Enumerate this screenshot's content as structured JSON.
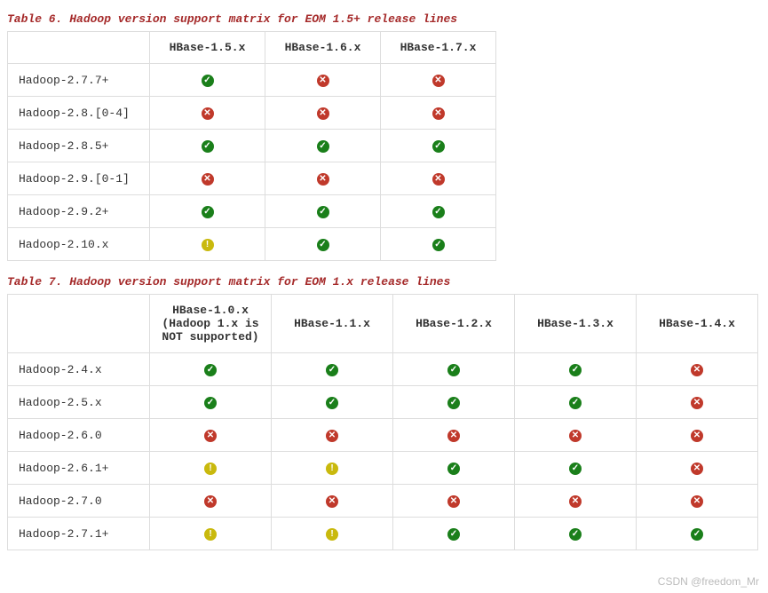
{
  "watermark": "CSDN @freedom_Mr",
  "icons": {
    "ok": "✓",
    "no": "✕",
    "wr": "!"
  },
  "table6": {
    "caption": "Table 6. Hadoop version support matrix for EOM 1.5+ release lines",
    "headers": [
      "HBase-1.5.x",
      "HBase-1.6.x",
      "HBase-1.7.x"
    ],
    "rows": [
      {
        "label": "Hadoop-2.7.7+",
        "cells": [
          "ok",
          "no",
          "no"
        ]
      },
      {
        "label": "Hadoop-2.8.[0-4]",
        "cells": [
          "no",
          "no",
          "no"
        ]
      },
      {
        "label": "Hadoop-2.8.5+",
        "cells": [
          "ok",
          "ok",
          "ok"
        ]
      },
      {
        "label": "Hadoop-2.9.[0-1]",
        "cells": [
          "no",
          "no",
          "no"
        ]
      },
      {
        "label": "Hadoop-2.9.2+",
        "cells": [
          "ok",
          "ok",
          "ok"
        ]
      },
      {
        "label": "Hadoop-2.10.x",
        "cells": [
          "wr",
          "ok",
          "ok"
        ]
      }
    ]
  },
  "table7": {
    "caption": "Table 7. Hadoop version support matrix for EOM 1.x release lines",
    "headers": [
      "HBase-1.0.x (Hadoop 1.x is NOT supported)",
      "HBase-1.1.x",
      "HBase-1.2.x",
      "HBase-1.3.x",
      "HBase-1.4.x"
    ],
    "rows": [
      {
        "label": "Hadoop-2.4.x",
        "cells": [
          "ok",
          "ok",
          "ok",
          "ok",
          "no"
        ]
      },
      {
        "label": "Hadoop-2.5.x",
        "cells": [
          "ok",
          "ok",
          "ok",
          "ok",
          "no"
        ]
      },
      {
        "label": "Hadoop-2.6.0",
        "cells": [
          "no",
          "no",
          "no",
          "no",
          "no"
        ]
      },
      {
        "label": "Hadoop-2.6.1+",
        "cells": [
          "wr",
          "wr",
          "ok",
          "ok",
          "no"
        ]
      },
      {
        "label": "Hadoop-2.7.0",
        "cells": [
          "no",
          "no",
          "no",
          "no",
          "no"
        ]
      },
      {
        "label": "Hadoop-2.7.1+",
        "cells": [
          "wr",
          "wr",
          "ok",
          "ok",
          "ok"
        ]
      }
    ]
  }
}
